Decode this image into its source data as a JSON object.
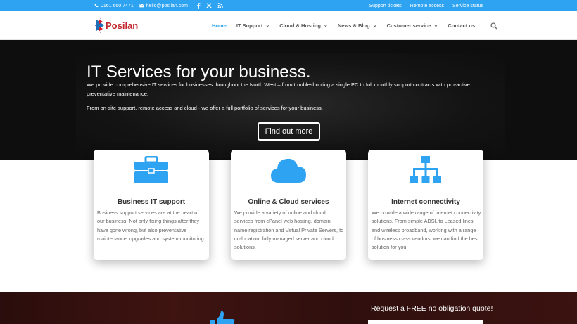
{
  "topbar": {
    "phone": "0161 660 7471",
    "email": "hello@posilan.com",
    "social_icons": [
      "facebook-icon",
      "x-twitter-icon",
      "rss-icon"
    ],
    "links": [
      "Support tickets",
      "Remote access",
      "Service status"
    ]
  },
  "header": {
    "logo_text": "Posilan",
    "nav": [
      {
        "label": "Home",
        "active": true,
        "dropdown": false
      },
      {
        "label": "IT Support",
        "active": false,
        "dropdown": true
      },
      {
        "label": "Cloud & Hosting",
        "active": false,
        "dropdown": true
      },
      {
        "label": "News & Blog",
        "active": false,
        "dropdown": true
      },
      {
        "label": "Customer service",
        "active": false,
        "dropdown": true
      },
      {
        "label": "Contact us",
        "active": false,
        "dropdown": false
      }
    ],
    "search_icon": "search-icon"
  },
  "hero": {
    "title": "IT Services for your business.",
    "paragraph1": "We provide comprehensive IT services for businesses throughout the North West – from troubleshooting a single PC to full monthly support contracts with pro-active preventative maintenance.",
    "paragraph2": "From on-site support, remote access and cloud - we offer a full portfolio of services for your business.",
    "button": "Find out more"
  },
  "cards": [
    {
      "icon": "briefcase-icon",
      "title": "Business IT support",
      "text": "Business support services are at the heart of our business. Not only fixing things after they have gone wrong, but also preventative maintenance, upgrades and system monitoring"
    },
    {
      "icon": "cloud-icon",
      "title": "Online & Cloud services",
      "text": "We provide a variety of online and cloud services from cPanel web hosting, domain name registration and Virtual Private Servers, to co-location, fully managed server and cloud solutions."
    },
    {
      "icon": "network-icon",
      "title": "Internet connectivity",
      "text": "We provide a wide range of internet connectivity solutions. From simple ADSL to Leased lines and wireless broadband, working with a range of business class vendors, we can find the best solution for you."
    }
  ],
  "bottom": {
    "quote_heading": "Request a FREE no obligation quote!",
    "icon": "thumbs-up-icon"
  },
  "colors": {
    "accent": "#2ea3f2",
    "hero_bg": "#0e0e0e",
    "bottom_bg": "#3a1210"
  }
}
